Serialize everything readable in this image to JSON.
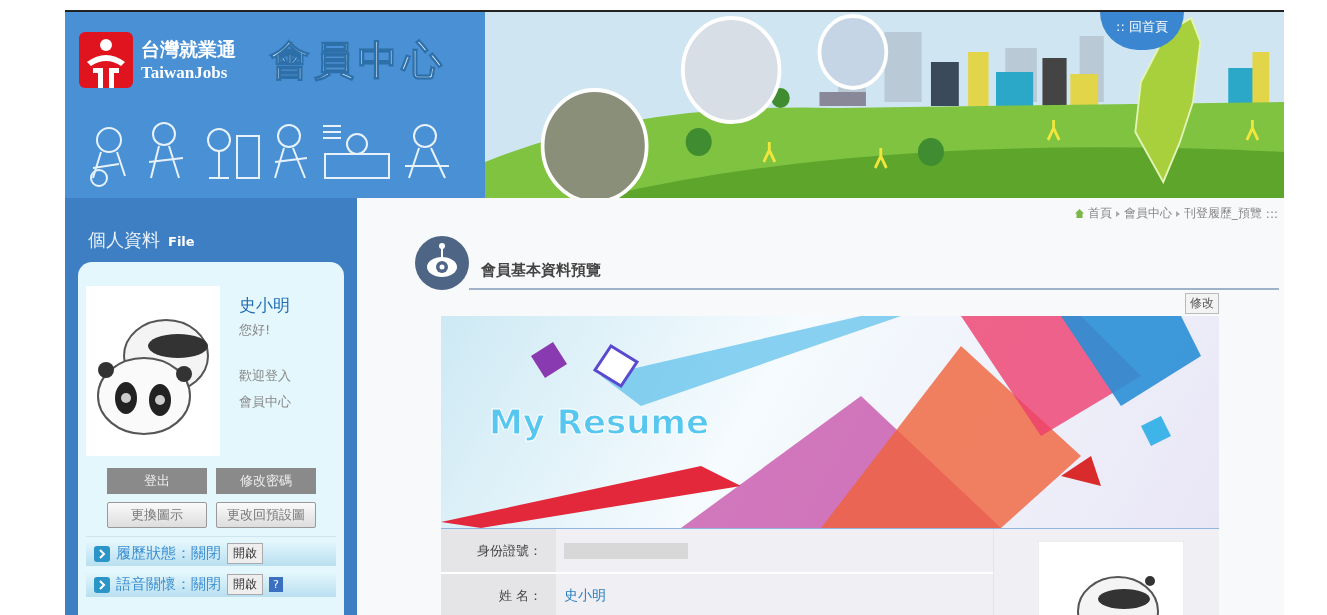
{
  "header": {
    "logo_cn": "台灣就業通",
    "logo_en": "TaiwanJobs",
    "title": "會員中心",
    "home_link": ":: 回首頁"
  },
  "sidebar": {
    "title": "個人資料",
    "title_en": "File",
    "name": "史小明",
    "greeting": "您好!",
    "welcome": [
      "歡迎登入",
      "會員中心"
    ],
    "buttons": [
      {
        "label": "登出",
        "kind": "solid"
      },
      {
        "label": "修改密碼",
        "kind": "solid"
      },
      {
        "label": "更換圖示",
        "kind": "outline"
      },
      {
        "label": "更改回預設圖",
        "kind": "outline"
      }
    ],
    "statuses": [
      {
        "label": "履歷狀態：",
        "value": "關閉",
        "button": "開啟"
      },
      {
        "label": "語音關懷：",
        "value": "關閉",
        "button": "開啟",
        "help": "?"
      }
    ]
  },
  "breadcrumb": {
    "items": [
      "首頁",
      "會員中心",
      "刊登履歷_預覽"
    ],
    "end": ":::"
  },
  "section": {
    "title": "會員基本資料預覽",
    "edit_button": "修改",
    "banner_text": "My Resume",
    "rows": [
      {
        "label": "身份證號：",
        "masked": true
      },
      {
        "label": "姓 名：",
        "value": "史小明",
        "masked": false
      }
    ]
  }
}
